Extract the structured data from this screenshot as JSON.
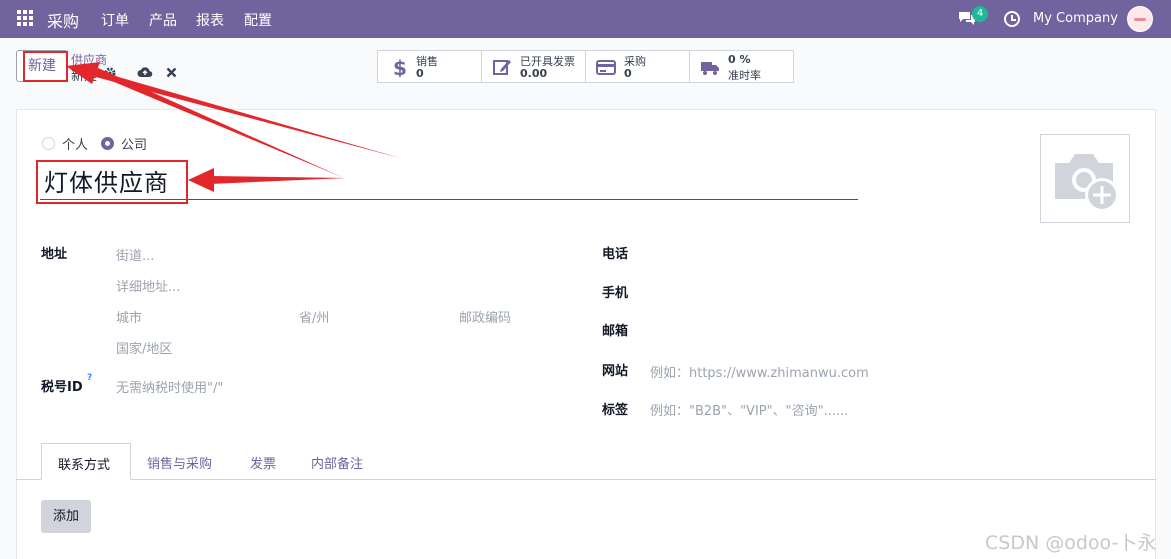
{
  "navbar": {
    "app_name": "采购",
    "menu": [
      "订单",
      "产品",
      "报表",
      "配置"
    ],
    "chat_count": "4",
    "company": "My Company"
  },
  "control": {
    "new_button": "新建",
    "breadcrumb_parent": "供应商",
    "breadcrumb_current": "新建"
  },
  "smart_buttons": [
    {
      "label": "销售",
      "value": "0"
    },
    {
      "label": "已开具发票",
      "value": "0.00"
    },
    {
      "label": "采购",
      "value": "0"
    },
    {
      "label": "0 %",
      "value": "准时率"
    }
  ],
  "form": {
    "type_individual": "个人",
    "type_company": "公司",
    "name": "灯体供应商",
    "address_label": "地址",
    "street_ph": "街道...",
    "street2_ph": "详细地址...",
    "city_ph": "城市",
    "state_ph": "省/州",
    "zip_ph": "邮政编码",
    "country_ph": "国家/地区",
    "vat_label": "税号ID",
    "vat_help": "?",
    "vat_ph": "无需纳税时使用\"/\"",
    "phone_label": "电话",
    "mobile_label": "手机",
    "email_label": "邮箱",
    "website_label": "网站",
    "website_ph": "例如：https://www.zhimanwu.com",
    "tags_label": "标签",
    "tags_ph": "例如：\"B2B\"、\"VIP\"、\"咨询\"......"
  },
  "tabs": [
    "联系方式",
    "销售与采购",
    "发票",
    "内部备注"
  ],
  "add_button": "添加",
  "watermark": "CSDN @odoo-卜永",
  "colors": {
    "navbar": "#71639e",
    "annotation": "#e3262b",
    "badge": "#21b799"
  }
}
